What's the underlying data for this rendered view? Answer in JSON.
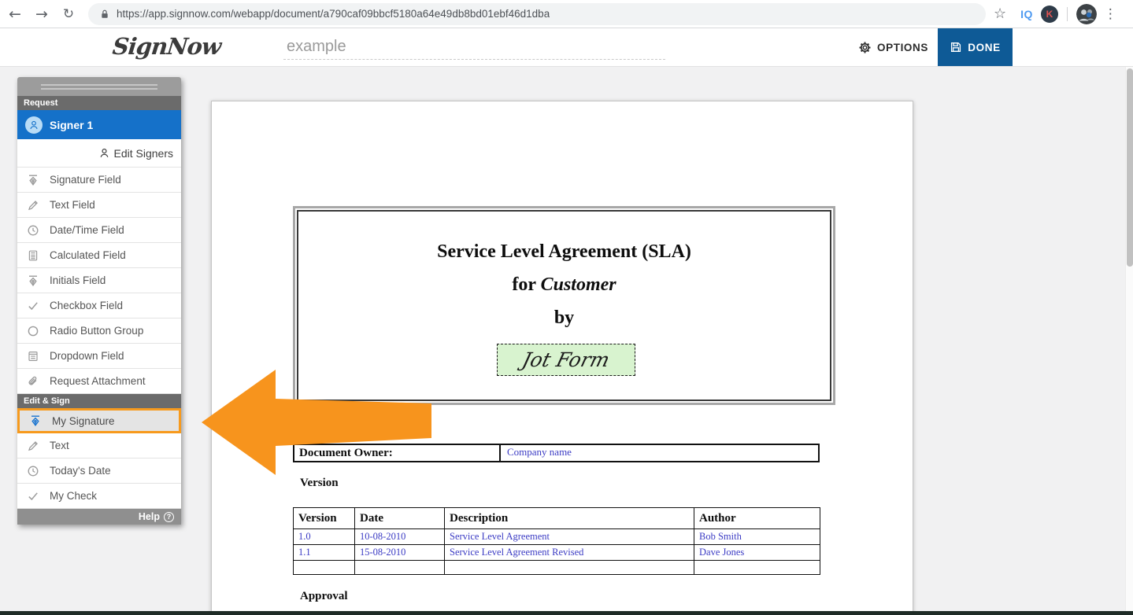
{
  "browser": {
    "url": "https://app.signnow.com/webapp/document/a790caf09bbcf5180a64e49db8bd01ebf46d1dba",
    "extension_iq": "IQ",
    "extension_k": "K"
  },
  "header": {
    "logo": "SignNow",
    "document_title": "example",
    "options_label": "OPTIONS",
    "done_label": "DONE"
  },
  "sidebar": {
    "request_header": "Request",
    "signer_label": "Signer 1",
    "edit_signers_label": "Edit Signers",
    "request_fields": [
      {
        "label": "Signature Field"
      },
      {
        "label": "Text Field"
      },
      {
        "label": "Date/Time Field"
      },
      {
        "label": "Calculated Field"
      },
      {
        "label": "Initials Field"
      },
      {
        "label": "Checkbox Field"
      },
      {
        "label": "Radio Button Group"
      },
      {
        "label": "Dropdown Field"
      },
      {
        "label": "Request Attachment"
      }
    ],
    "edit_sign_header": "Edit & Sign",
    "edit_sign_items": [
      {
        "label": "My Signature"
      },
      {
        "label": "Text"
      },
      {
        "label": "Today's Date"
      },
      {
        "label": "My Check"
      }
    ],
    "help_label": "Help",
    "help_q": "?"
  },
  "document": {
    "title_line1": "Service Level Agreement (SLA)",
    "title_line2_prefix": "for ",
    "title_line2_name": "Customer",
    "title_line3": "by",
    "signature_text": "Jot Form",
    "owner_label": "Document Owner:",
    "owner_value": "Company name",
    "version_heading": "Version",
    "approval_heading": "Approval",
    "version_table": {
      "headers": [
        "Version",
        "Date",
        "Description",
        "Author"
      ],
      "rows": [
        [
          "1.0",
          "10-08-2010",
          "Service Level Agreement",
          "Bob Smith"
        ],
        [
          "1.1",
          "15-08-2010",
          "Service Level Agreement Revised",
          "Dave Jones"
        ],
        [
          "",
          "",
          "",
          ""
        ]
      ]
    }
  },
  "colors": {
    "signer_blue": "#1571c9",
    "done_blue": "#0e5a96",
    "highlight_orange": "#f7941d",
    "signature_green": "#d8f3cf",
    "table_text_blue": "#3b3bc4",
    "section_bar_gray": "#6b6b6b"
  }
}
